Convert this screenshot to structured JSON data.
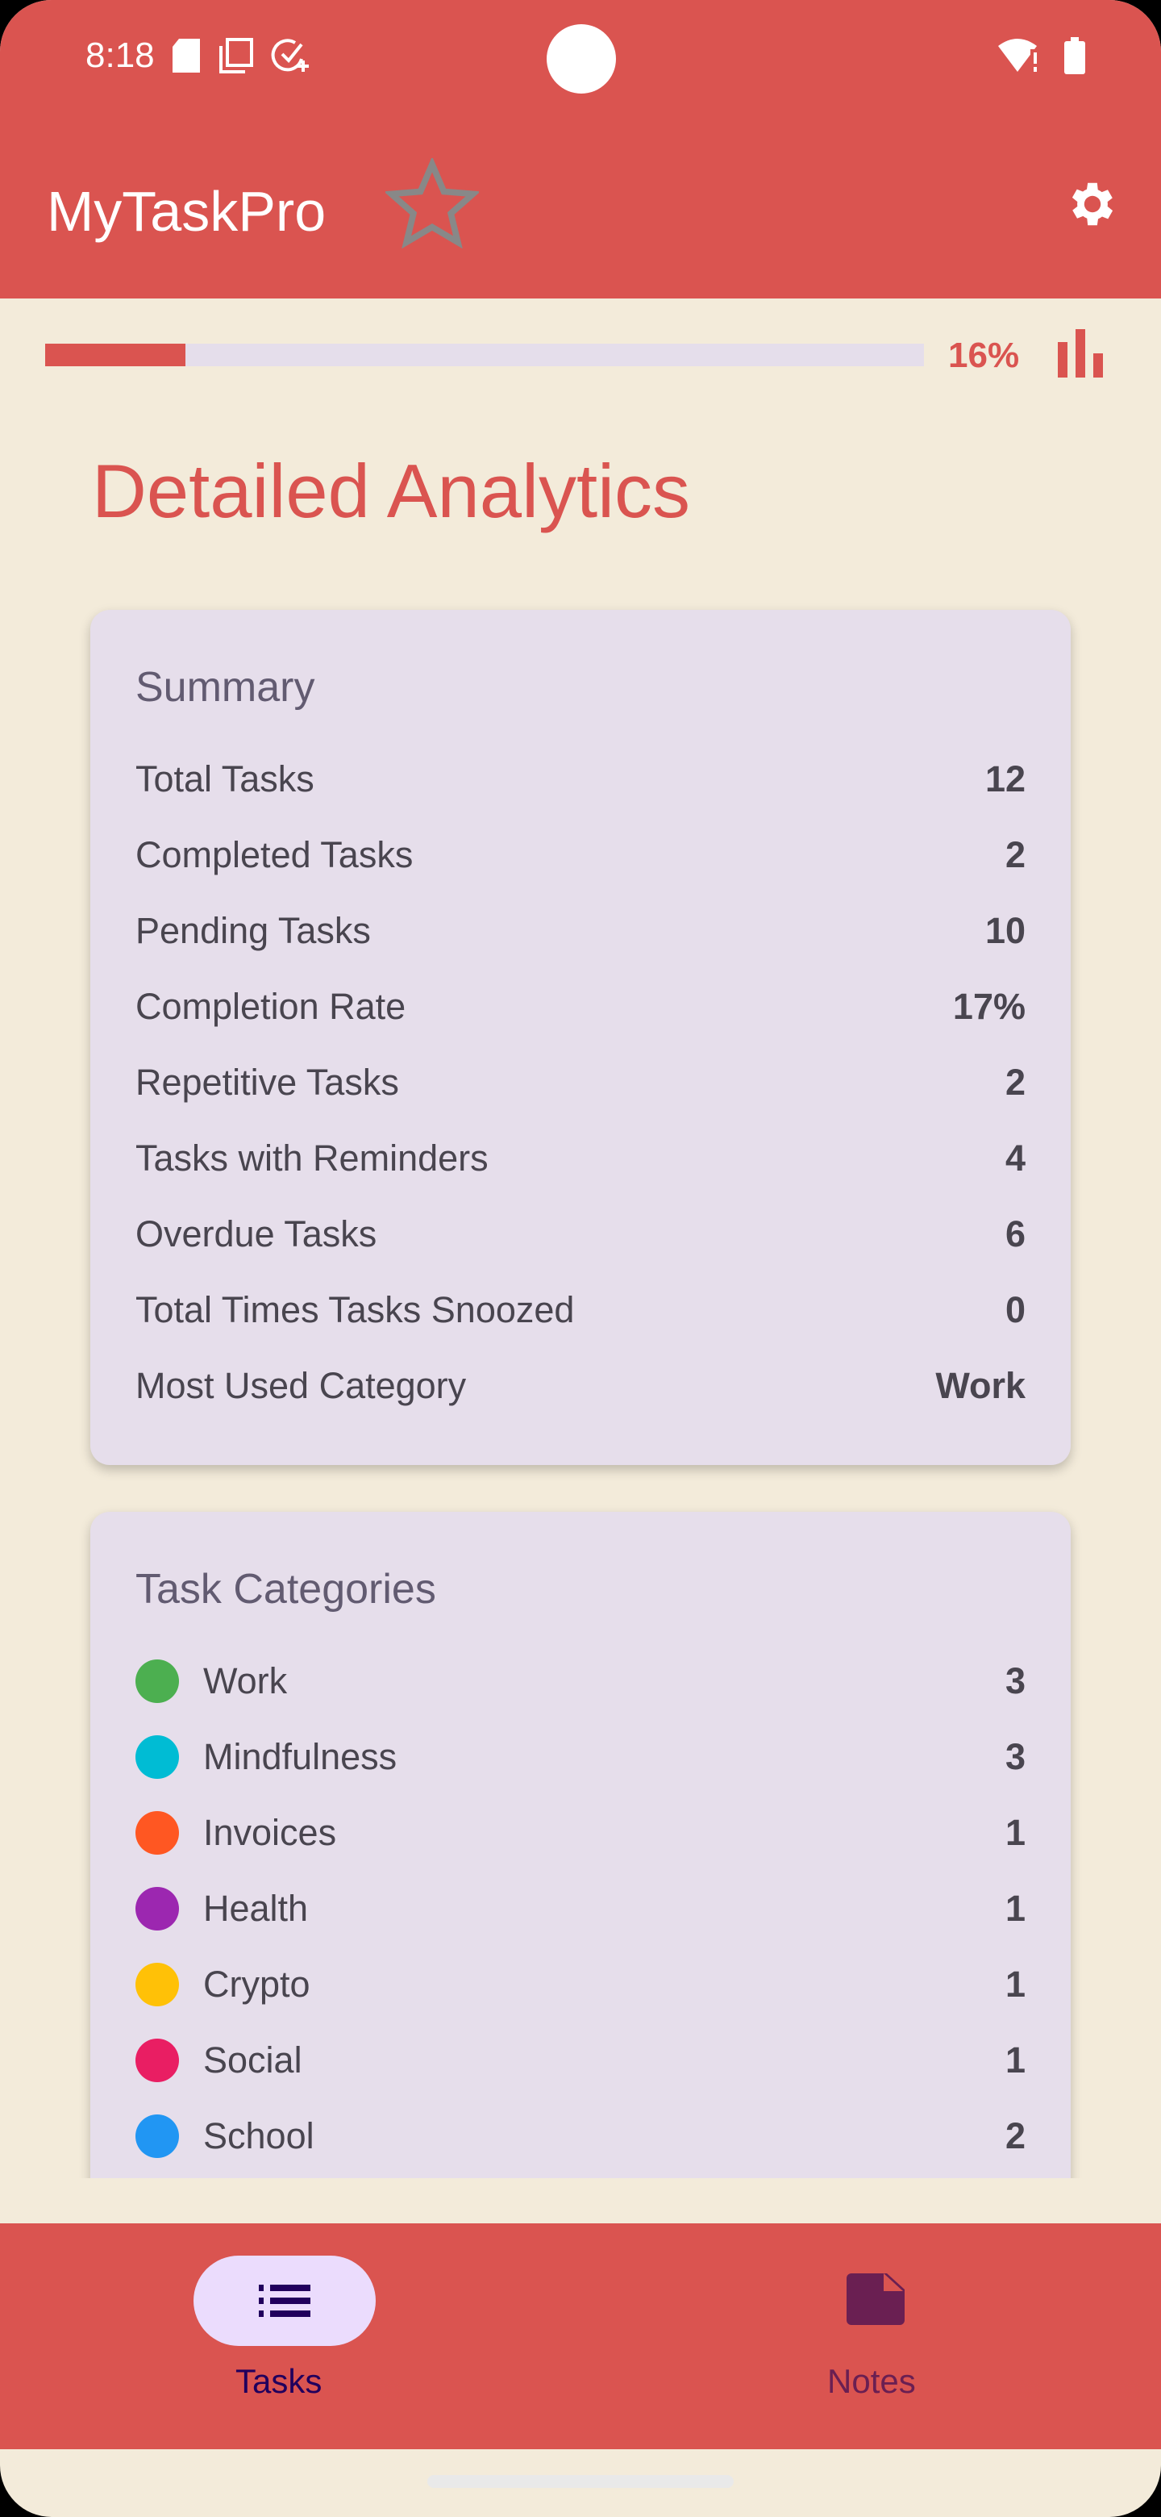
{
  "status_bar": {
    "time": "8:18"
  },
  "app_bar": {
    "title": "MyTaskPro"
  },
  "progress": {
    "value": 16,
    "label": "16%"
  },
  "page_title": "Detailed Analytics",
  "summary": {
    "heading": "Summary",
    "rows": [
      {
        "label": "Total Tasks",
        "value": "12"
      },
      {
        "label": "Completed Tasks",
        "value": "2"
      },
      {
        "label": "Pending Tasks",
        "value": "10"
      },
      {
        "label": "Completion Rate",
        "value": "17%"
      },
      {
        "label": "Repetitive Tasks",
        "value": "2"
      },
      {
        "label": "Tasks with Reminders",
        "value": "4"
      },
      {
        "label": "Overdue Tasks",
        "value": "6"
      },
      {
        "label": "Total Times Tasks Snoozed",
        "value": "0"
      },
      {
        "label": "Most Used Category",
        "value": "Work"
      }
    ]
  },
  "categories": {
    "heading": "Task Categories",
    "rows": [
      {
        "label": "Work",
        "value": "3",
        "color": "#4CAF50"
      },
      {
        "label": "Mindfulness",
        "value": "3",
        "color": "#00BCD4"
      },
      {
        "label": "Invoices",
        "value": "1",
        "color": "#FF5722"
      },
      {
        "label": "Health",
        "value": "1",
        "color": "#9C27B0"
      },
      {
        "label": "Crypto",
        "value": "1",
        "color": "#FFC107"
      },
      {
        "label": "Social",
        "value": "1",
        "color": "#E91E63"
      },
      {
        "label": "School",
        "value": "2",
        "color": "#2196F3"
      }
    ]
  },
  "bottom_nav": {
    "items": [
      {
        "label": "Tasks",
        "icon": "list-icon",
        "selected": true
      },
      {
        "label": "Notes",
        "icon": "note-icon",
        "selected": false
      }
    ]
  },
  "colors": {
    "primary": "#DA5450",
    "background": "#F3EBDA",
    "card": "#E6DEEB"
  }
}
